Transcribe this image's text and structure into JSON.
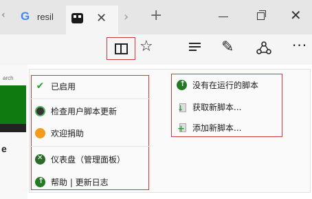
{
  "tabs": [
    {
      "label": "resil",
      "icon": "google-g-icon",
      "favicon_text": "G"
    },
    {
      "label": "",
      "icon": "extension-icon"
    }
  ],
  "tab_close_glyph": "✕",
  "new_tab_glyph": "+",
  "toolbar": {
    "icons": [
      "reading-view-icon",
      "favorite-star-icon",
      "hub-icon",
      "web-note-icon",
      "share-icon",
      "more-icon"
    ],
    "star_glyph": "☆",
    "note_glyph": "✎",
    "more_glyph": "···"
  },
  "page": {
    "search_snippet": "arch",
    "letter": "e"
  },
  "menu": {
    "left": [
      {
        "label": "已启用",
        "icon": "check-icon"
      },
      {
        "label": "检查用户脚本更新",
        "icon": "update-icon"
      },
      {
        "label": "欢迎捐助",
        "icon": "donate-icon"
      },
      {
        "label": "仪表盘（管理面板）",
        "icon": "dashboard-icon"
      },
      {
        "label": "帮助 | 更新日志",
        "icon": "help-icon"
      }
    ],
    "right": [
      {
        "label": "没有在运行的脚本",
        "icon": "no-script-icon"
      },
      {
        "label": "获取新脚本...",
        "icon": "get-script-icon"
      },
      {
        "label": "添加新脚本...",
        "icon": "add-script-icon"
      }
    ]
  },
  "colors": {
    "highlight_border": "#c43c3c",
    "tabbar_bg": "#e6e6e6",
    "toolbar_bg": "#f5f5f5",
    "green_accent": "#2e9c2e"
  }
}
